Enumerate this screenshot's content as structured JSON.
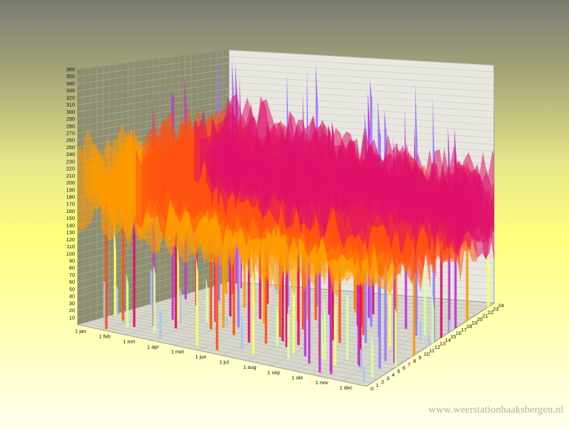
{
  "chart_data": {
    "type": "area",
    "subtype": "3d-surface",
    "title": "",
    "xlabel": "",
    "ylabel": "",
    "zlabel": "",
    "z_ticks": [
      10,
      20,
      30,
      40,
      50,
      60,
      70,
      80,
      90,
      100,
      110,
      120,
      130,
      140,
      150,
      160,
      170,
      180,
      190,
      200,
      210,
      220,
      230,
      240,
      250,
      260,
      270,
      280,
      290,
      300,
      310,
      320,
      330,
      340,
      350,
      360
    ],
    "z_range": [
      0,
      360
    ],
    "x_ticks": [
      "1 jan",
      "1 feb",
      "1 mrt",
      "1 apr",
      "1 mei",
      "1 jun",
      "1 jul",
      "1 aug",
      "1 sep",
      "1 okt",
      "1 nov",
      "1 dec"
    ],
    "x_range": [
      "1 jan",
      "31 dec"
    ],
    "y_ticks": [
      "0",
      "1",
      "2",
      "3",
      "4",
      "5",
      "6",
      "7",
      "8",
      "9",
      "10",
      "11",
      "12",
      "13",
      "14",
      "15",
      "16",
      "17",
      "18",
      "19",
      "20",
      "21",
      "22",
      "23",
      "24"
    ],
    "y_range": [
      0,
      24
    ],
    "grid": true,
    "color_bands": [
      {
        "from": 0,
        "to": 60,
        "color": "#a8c8f0"
      },
      {
        "from": 60,
        "to": 110,
        "color": "#d8ffa0"
      },
      {
        "from": 110,
        "to": 150,
        "color": "#ffff60"
      },
      {
        "from": 150,
        "to": 190,
        "color": "#ff9a00"
      },
      {
        "from": 190,
        "to": 230,
        "color": "#ff5010"
      },
      {
        "from": 230,
        "to": 280,
        "color": "#e0106a"
      },
      {
        "from": 280,
        "to": 320,
        "color": "#c038d0"
      },
      {
        "from": 320,
        "to": 360,
        "color": "#9a78ff"
      }
    ],
    "band_profile": [
      {
        "x": "1 jan",
        "lower": 190,
        "upper": 250
      },
      {
        "x": "1 mrt",
        "lower": 140,
        "upper": 200
      },
      {
        "x": "1 mei",
        "lower": 150,
        "upper": 230
      },
      {
        "x": "1 jul",
        "lower": 140,
        "upper": 220
      },
      {
        "x": "1 sep",
        "lower": 130,
        "upper": 210
      },
      {
        "x": "1 nov",
        "lower": 150,
        "upper": 230
      },
      {
        "x": "31 dec",
        "lower": 180,
        "upper": 250
      }
    ]
  },
  "watermark": "www.weerstationhaaksbergen.nl"
}
